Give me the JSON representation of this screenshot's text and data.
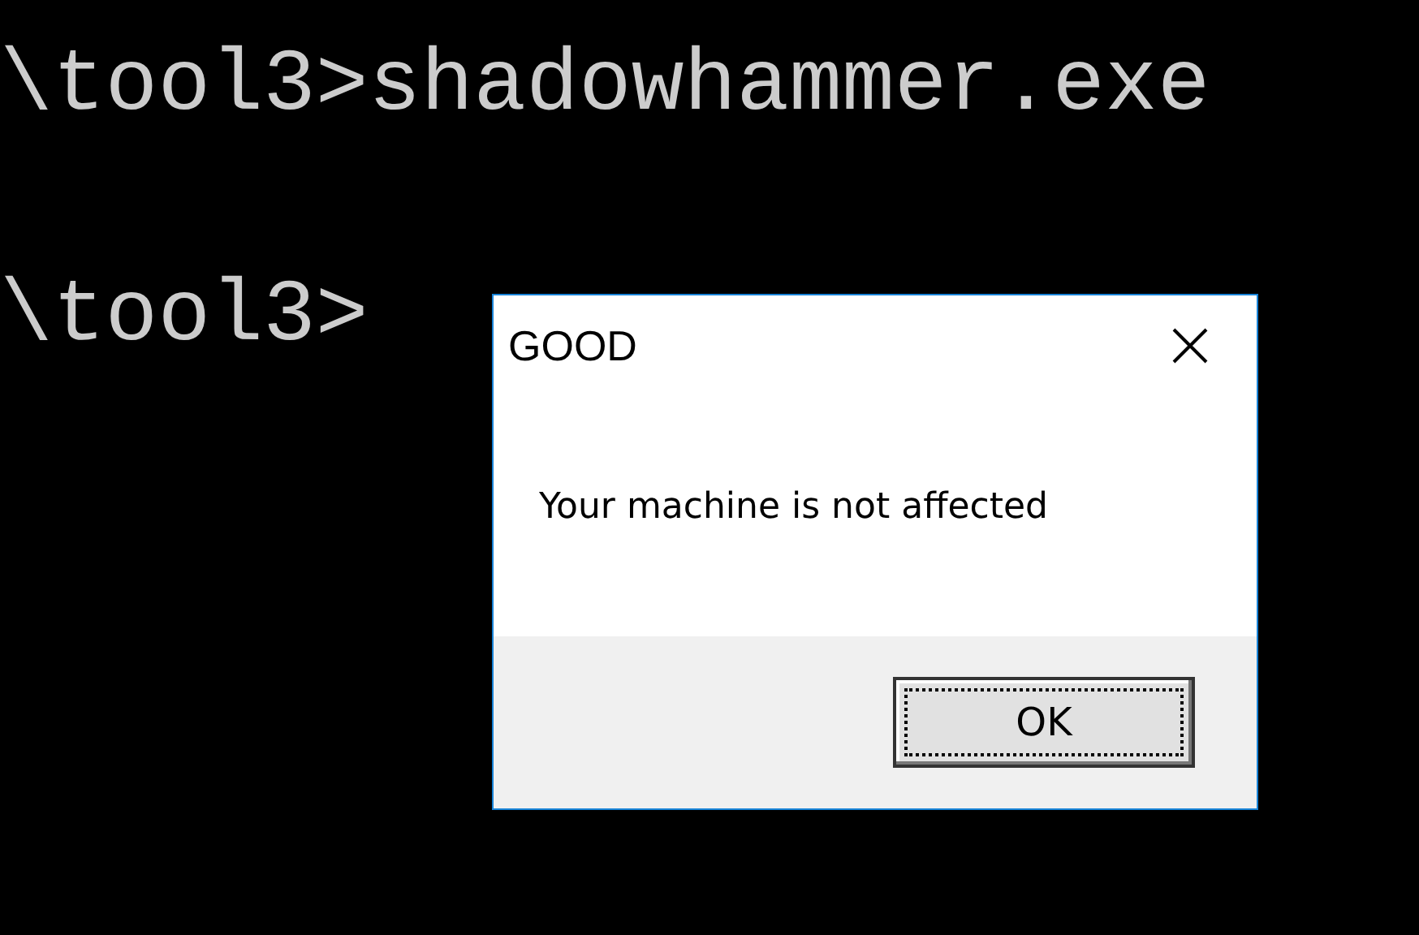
{
  "console": {
    "lines": [
      "\\tool3>shadowhammer.exe",
      "\\tool3>"
    ]
  },
  "dialog": {
    "title": "GOOD",
    "message": "Your machine is not affected",
    "buttons": [
      {
        "label": "OK",
        "focused": true
      }
    ]
  }
}
